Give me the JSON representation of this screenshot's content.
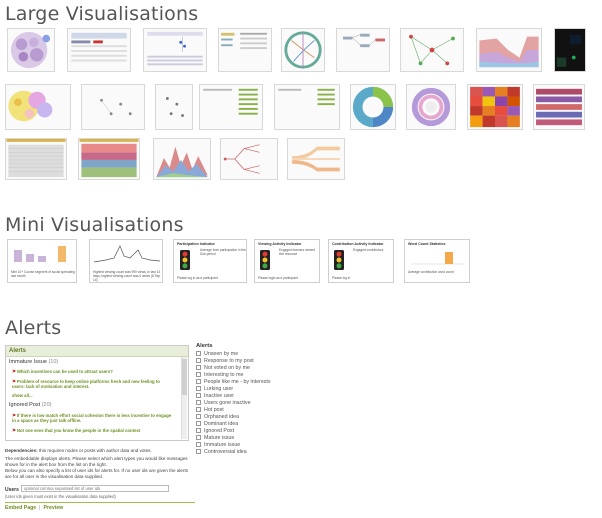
{
  "sections": {
    "large": "Large Visualisations",
    "mini": "Mini Visualisations",
    "alerts": "Alerts"
  },
  "mini_visualisations": [
    {
      "title": "",
      "text": "Mini 10+ Course segment of social spreading last month"
    },
    {
      "title": "",
      "text": "Highest viewing count was 990 views; in last 14 days; highest viewing count was 0 views (8 Sep 14)"
    },
    {
      "title": "Participation Indicator",
      "text": "Please log in as a participant",
      "subtitle": "Average from participation in the Sub-period"
    },
    {
      "title": "Viewing Activity Indicator",
      "text": "Please login as a participant",
      "subtitle": "Engaged learners viewed this resource"
    },
    {
      "title": "Contribution Activity Indicator",
      "text": "Please log in",
      "subtitle": "Engaged contributors"
    },
    {
      "title": "Word Count Statistics",
      "text": "Average contribution word count"
    }
  ],
  "alerts_panel": {
    "header": "Alerts",
    "groups": [
      {
        "label": "Immature Issue",
        "count": "(10)"
      },
      {
        "label": "Ignored Post",
        "count": "(20)"
      }
    ],
    "items": [
      "Which incentives can be used to attract users?",
      "Problem of resource to keep online platforms fresh and new feeling to users: lack of motivation and interest.",
      "If there is low match effort social cohesion there is less incentive to engage in a space as they just talk offline.",
      "Not one sees that you know the people in the spatial context"
    ],
    "show_all": "show all..."
  },
  "description": {
    "dependencies_label": "Dependencies:",
    "dependencies_text": "this requires nodes or posts with author data and votes.",
    "line1": "The embeddable displays alerts. Please select which alert types you would like messages shown for in the alert box from the list on the right.",
    "line2": "Below you can also specify a list of user ids for alerts for. If no user ids are given the alerts are for all user in the visualisation data supplied."
  },
  "alert_types": {
    "title": "Alerts",
    "options": [
      "Unseen by me",
      "Response to my post",
      "Not voted on by me",
      "Interesting to me",
      "People like me - by interests",
      "Lurking user",
      "Inactive user",
      "Users gone inactive",
      "Hot post",
      "Orphaned idea",
      "Dominant idea",
      "Ignored Post",
      "Mature issue",
      "Immature issue",
      "Controversial idea"
    ]
  },
  "users": {
    "label": "Users",
    "placeholder": "optional comma separated list of user ids",
    "hint": "(User ids given must exist in the visualisation data supplied)"
  },
  "footer": {
    "embed": "Embed Page",
    "preview": "Preview"
  },
  "colors": {
    "accent_green": "#6c8f1f",
    "alert_red": "#c0392b",
    "panel_header": "#e9eeda"
  }
}
